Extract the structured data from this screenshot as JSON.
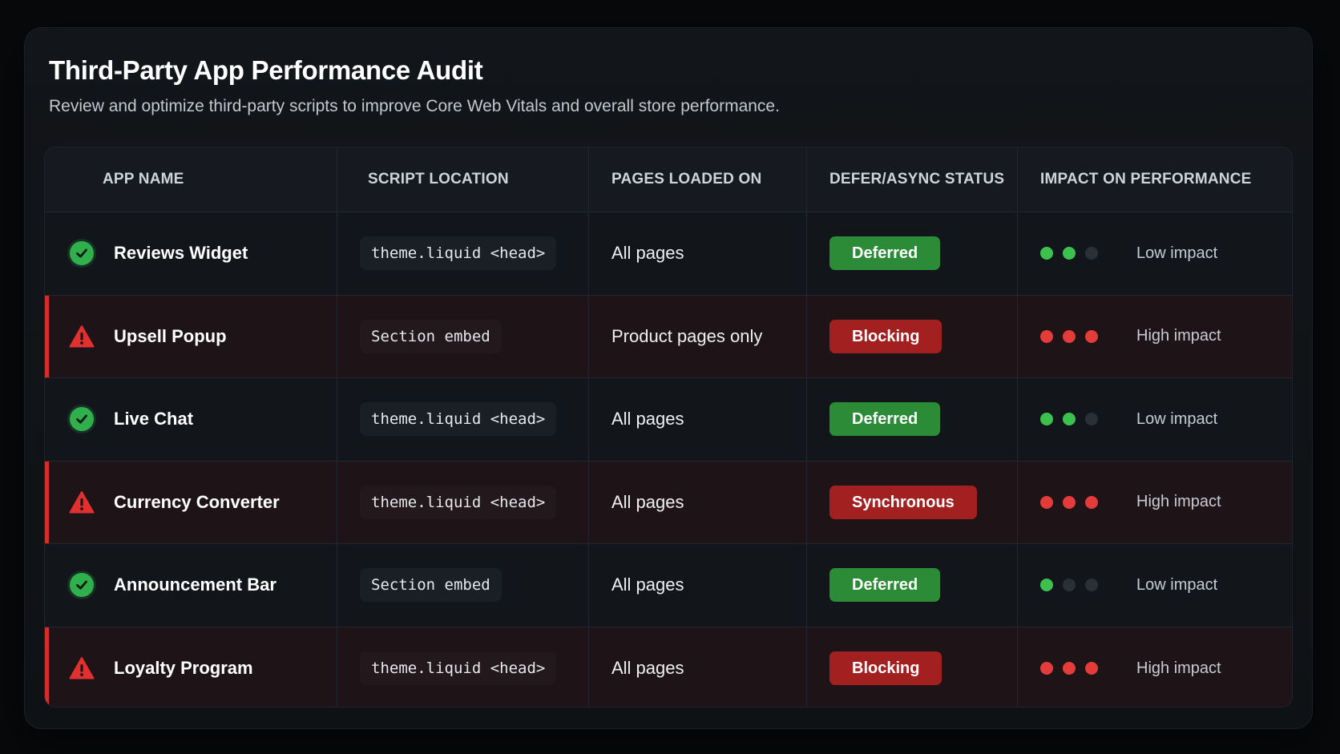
{
  "header": {
    "title": "Third-Party App Performance Audit",
    "subtitle": "Review and optimize third-party scripts to improve Core Web Vitals and overall store performance."
  },
  "columns": [
    "APP NAME",
    "SCRIPT LOCATION",
    "PAGES LOADED ON",
    "DEFER/ASYNC STATUS",
    "IMPACT ON PERFORMANCE"
  ],
  "colors": {
    "green": "#2b8b36",
    "red": "#a32020",
    "accent_red": "#d62c2c"
  },
  "rows": [
    {
      "app": "Reviews Widget",
      "status_icon": "check-circle-icon",
      "location": "theme.liquid <head>",
      "pages": "All pages",
      "status": "Deferred",
      "status_color": "green",
      "impact_level": 2,
      "impact_max": 3,
      "impact": "Low impact",
      "severity": "low"
    },
    {
      "app": "Upsell Popup",
      "status_icon": "warning-triangle-icon",
      "location": "Section embed",
      "pages": "Product pages only",
      "status": "Blocking",
      "status_color": "red",
      "impact_level": 3,
      "impact_max": 3,
      "impact": "High impact",
      "severity": "high"
    },
    {
      "app": "Live Chat",
      "status_icon": "check-circle-icon",
      "location": "theme.liquid <head>",
      "pages": "All pages",
      "status": "Deferred",
      "status_color": "green",
      "impact_level": 2,
      "impact_max": 3,
      "impact": "Low impact",
      "severity": "low"
    },
    {
      "app": "Currency Converter",
      "status_icon": "warning-triangle-icon",
      "location": "theme.liquid <head>",
      "pages": "All pages",
      "status": "Synchronous",
      "status_color": "red",
      "impact_level": 3,
      "impact_max": 3,
      "impact": "High impact",
      "severity": "high"
    },
    {
      "app": "Announcement Bar",
      "status_icon": "check-circle-icon",
      "location": "Section embed",
      "pages": "All pages",
      "status": "Deferred",
      "status_color": "green",
      "impact_level": 1,
      "impact_max": 3,
      "impact": "Low impact",
      "severity": "low"
    },
    {
      "app": "Loyalty Program",
      "status_icon": "warning-triangle-icon",
      "location": "theme.liquid <head>",
      "pages": "All pages",
      "status": "Blocking",
      "status_color": "red",
      "impact_level": 3,
      "impact_max": 3,
      "impact": "High impact",
      "severity": "high"
    }
  ]
}
